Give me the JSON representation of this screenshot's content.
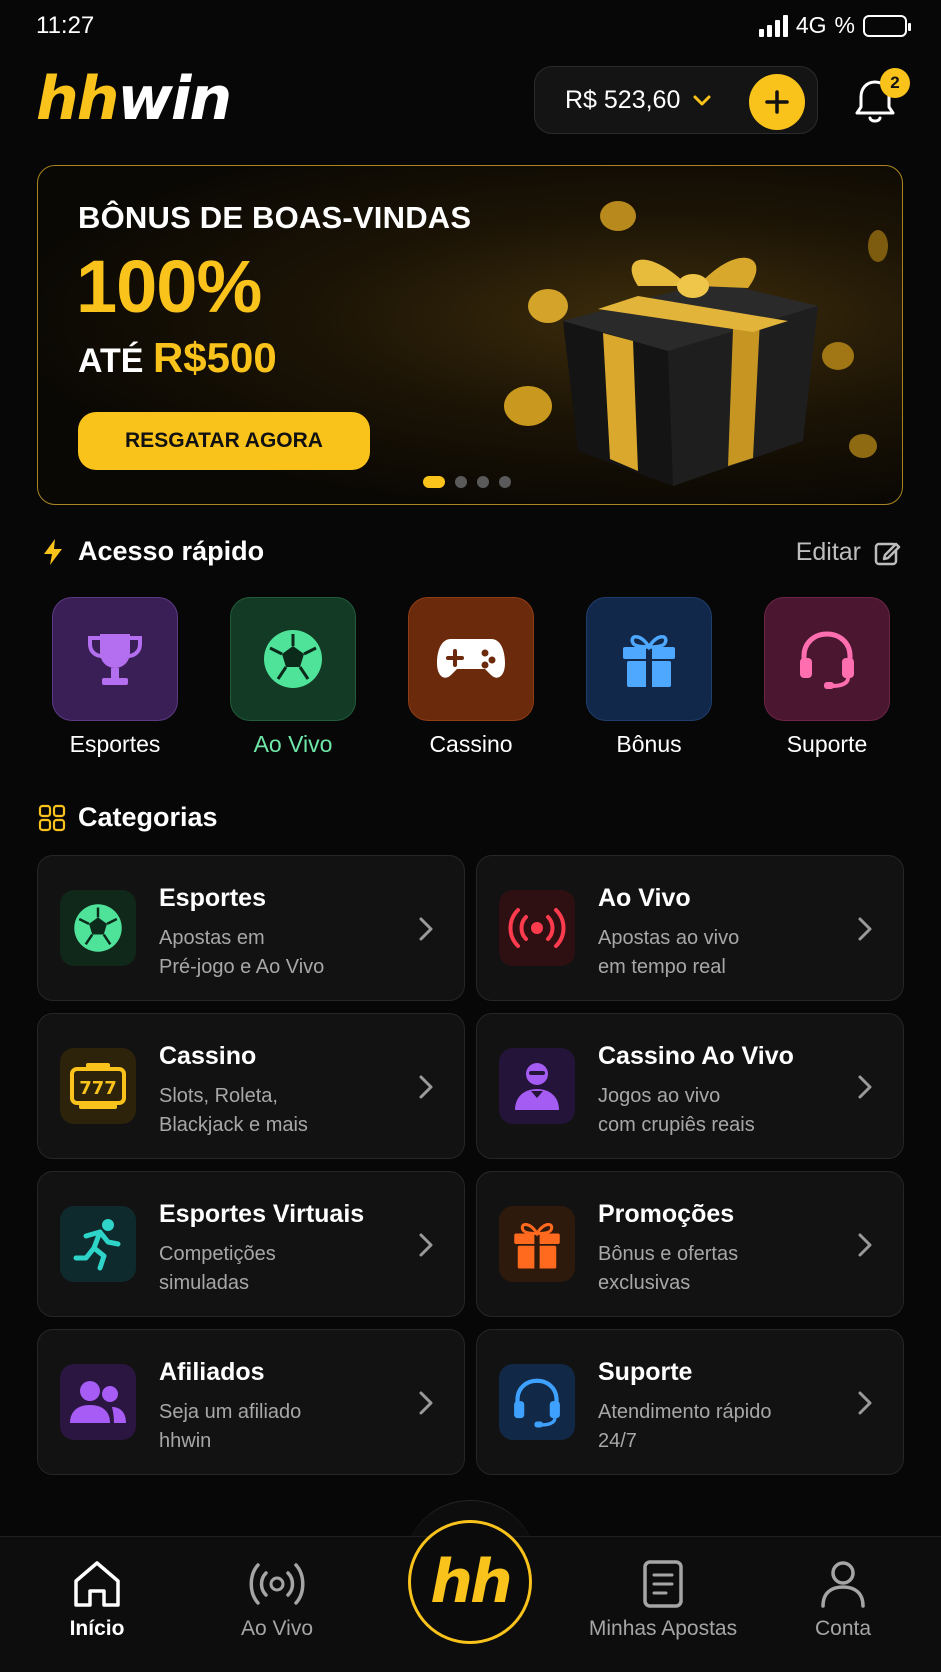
{
  "status": {
    "time": "11:27",
    "network": "4G",
    "pct": "%",
    "battery": ""
  },
  "header": {
    "logo_hh": "hh",
    "logo_win": "win",
    "balance": "R$ 523,60",
    "notifications": "2",
    "accent": "#f9c31b"
  },
  "banner": {
    "subtitle": "BÔNUS DE BOAS-VINDAS",
    "headline": "100%",
    "prefix": "ATÉ",
    "amount": "R$500",
    "cta": "RESGATAR AGORA",
    "slides": 4,
    "active_slide": 1
  },
  "quick": {
    "title": "Acesso rápido",
    "edit": "Editar",
    "items": [
      {
        "label": "Esportes",
        "icon": "trophy-icon"
      },
      {
        "label": "Ao Vivo",
        "icon": "soccer-ball-icon"
      },
      {
        "label": "Cassino",
        "icon": "gamepad-icon"
      },
      {
        "label": "Bônus",
        "icon": "gift-icon"
      },
      {
        "label": "Suporte",
        "icon": "headset-icon"
      }
    ]
  },
  "categories": {
    "title": "Categorias",
    "items": [
      {
        "title": "Esportes",
        "desc1": "Apostas em",
        "desc2": "Pré-jogo e Ao Vivo",
        "icon": "soccer-ball-icon"
      },
      {
        "title": "Ao Vivo",
        "desc1": "Apostas ao vivo",
        "desc2": "em tempo real",
        "icon": "broadcast-icon"
      },
      {
        "title": "Cassino",
        "desc1": "Slots, Roleta,",
        "desc2": "Blackjack e mais",
        "icon": "slot-machine-icon"
      },
      {
        "title": "Cassino Ao Vivo",
        "desc1": "Jogos ao vivo",
        "desc2": "com crupiês reais",
        "icon": "dealer-icon"
      },
      {
        "title": "Esportes Virtuais",
        "desc1": "Competições",
        "desc2": "simuladas",
        "icon": "runner-icon"
      },
      {
        "title": "Promoções",
        "desc1": "Bônus e ofertas",
        "desc2": "exclusivas",
        "icon": "gift-icon"
      },
      {
        "title": "Afiliados",
        "desc1": "Seja um afiliado",
        "desc2": "hhwin",
        "icon": "users-icon"
      },
      {
        "title": "Suporte",
        "desc1": "Atendimento rápido",
        "desc2": "24/7",
        "icon": "headset-icon"
      }
    ]
  },
  "nav": {
    "items": [
      {
        "label": "Início",
        "icon": "home-icon",
        "active": true
      },
      {
        "label": "Ao Vivo",
        "icon": "broadcast-icon"
      },
      {
        "label": "Minhas Apostas",
        "icon": "receipt-icon"
      },
      {
        "label": "Conta",
        "icon": "user-icon"
      }
    ],
    "center": "hh"
  }
}
